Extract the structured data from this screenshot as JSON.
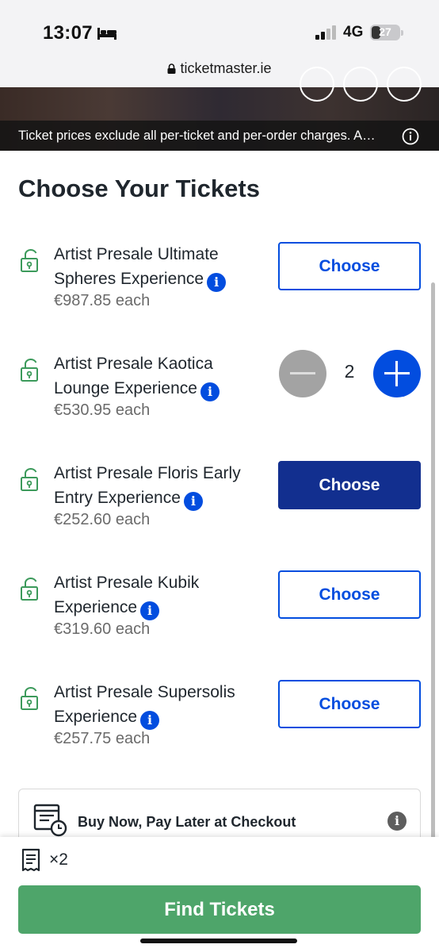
{
  "status_bar": {
    "time": "13:07",
    "network": "4G",
    "battery": "27"
  },
  "browser": {
    "url": "ticketmaster.ie"
  },
  "banner": {
    "notice": "Ticket prices exclude all per-ticket and per-order charges. A…"
  },
  "page": {
    "title": "Choose Your Tickets"
  },
  "tickets": [
    {
      "name": "Artist Presale Ultimate Spheres Experience",
      "price": "€987.85 each",
      "action": "Choose",
      "state": "default"
    },
    {
      "name": "Artist Presale Kaotica Lounge Experience",
      "price": "€530.95 each",
      "quantity": "2",
      "state": "selected"
    },
    {
      "name": "Artist Presale Floris Early Entry Experience",
      "price": "€252.60 each",
      "action": "Choose",
      "state": "active"
    },
    {
      "name": "Artist Presale Kubik Experience",
      "price": "€319.60 each",
      "action": "Choose",
      "state": "default"
    },
    {
      "name": "Artist Presale Supersolis Experience",
      "price": "€257.75 each",
      "action": "Choose",
      "state": "default"
    }
  ],
  "bnpl": {
    "label": "Buy Now, Pay Later at Checkout"
  },
  "footer": {
    "ticket_count": "×2",
    "find_button": "Find Tickets"
  },
  "colors": {
    "accent_blue": "#024ddf",
    "active_navy": "#122f8f",
    "cta_green": "#4ea56a",
    "lock_green": "#3c9a5b"
  },
  "icons": [
    "bed-icon",
    "signal-icon",
    "battery-icon",
    "lock-icon",
    "info-icon",
    "minus-icon",
    "plus-icon",
    "receipt-clock-icon",
    "ticket-icon"
  ]
}
